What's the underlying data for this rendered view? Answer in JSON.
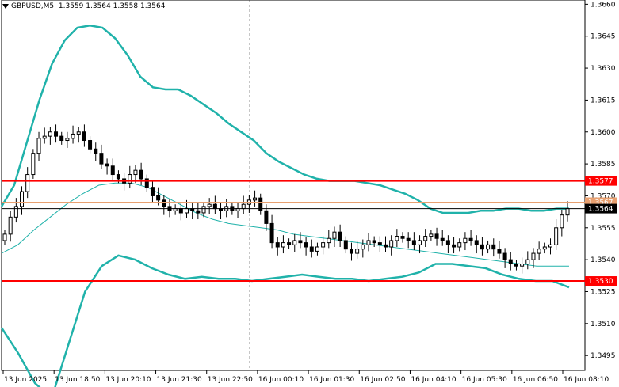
{
  "header": {
    "symbol": "GBPUSD,M5",
    "ohlc": "1.3559 1.3564 1.3558 1.3564"
  },
  "colors": {
    "band": "#20b2aa",
    "level": "#ff0000",
    "current": "#e8a070",
    "candle": "#000000",
    "axis": "#000000"
  },
  "chart_data": {
    "type": "candlestick",
    "ylim": [
      1.3488,
      1.3662
    ],
    "y_ticks": [
      "1.3660",
      "1.3645",
      "1.3630",
      "1.3615",
      "1.3600",
      "1.3585",
      "1.3570",
      "1.3555",
      "1.3540",
      "1.3525",
      "1.3510",
      "1.3495"
    ],
    "x_ticks": [
      "13 Jun 2025",
      "13 Jun 18:50",
      "13 Jun 20:10",
      "13 Jun 21:30",
      "13 Jun 22:50",
      "16 Jun 00:10",
      "16 Jun 01:30",
      "16 Jun 02:50",
      "16 Jun 04:10",
      "16 Jun 05:30",
      "16 Jun 06:50",
      "16 Jun 08:10"
    ],
    "horizontal_levels": [
      {
        "label": "1.3577",
        "value": 1.3577,
        "color": "#ff0000"
      },
      {
        "label": "1.3530",
        "value": 1.353,
        "color": "#ff0000"
      }
    ],
    "price_tags": [
      {
        "label": "1.3567",
        "value": 1.3567,
        "color": "#e8a070"
      },
      {
        "label": "1.3564",
        "value": 1.3564,
        "color": "#000000"
      }
    ],
    "closes": [
      1.3552,
      1.356,
      1.3565,
      1.3572,
      1.358,
      1.359,
      1.3597,
      1.3598,
      1.36,
      1.3598,
      1.3596,
      1.3597,
      1.3599,
      1.36,
      1.3596,
      1.3592,
      1.359,
      1.3585,
      1.3584,
      1.358,
      1.3578,
      1.3576,
      1.358,
      1.3582,
      1.3578,
      1.3574,
      1.357,
      1.3568,
      1.3565,
      1.3563,
      1.3564,
      1.3562,
      1.3564,
      1.3563,
      1.3562,
      1.3565,
      1.3566,
      1.3564,
      1.3563,
      1.3565,
      1.3563,
      1.3564,
      1.3566,
      1.3568,
      1.3569,
      1.3563,
      1.3557,
      1.3548,
      1.3546,
      1.3548,
      1.3547,
      1.3549,
      1.3548,
      1.3546,
      1.3544,
      1.3546,
      1.3548,
      1.355,
      1.3553,
      1.3549,
      1.3545,
      1.3543,
      1.3545,
      1.3547,
      1.3549,
      1.3548,
      1.3547,
      1.3546,
      1.3549,
      1.3551,
      1.355,
      1.3549,
      1.3547,
      1.3549,
      1.3551,
      1.3552,
      1.355,
      1.3549,
      1.3547,
      1.3546,
      1.3548,
      1.355,
      1.3549,
      1.3547,
      1.3545,
      1.3547,
      1.3545,
      1.3543,
      1.354,
      1.3538,
      1.3537,
      1.3538,
      1.354,
      1.3543,
      1.3545,
      1.3546,
      1.3547,
      1.3555,
      1.3561,
      1.3564
    ],
    "upper_band": [
      1.3565,
      1.3575,
      1.3595,
      1.3615,
      1.3632,
      1.3643,
      1.3649,
      1.365,
      1.3649,
      1.3644,
      1.3636,
      1.3626,
      1.3621,
      1.362,
      1.362,
      1.3617,
      1.3613,
      1.3609,
      1.3604,
      1.36,
      1.3596,
      1.359,
      1.3586,
      1.3583,
      1.358,
      1.3578,
      1.3577,
      1.3577,
      1.3577,
      1.3576,
      1.3575,
      1.3573,
      1.3571,
      1.3568,
      1.3564,
      1.3562,
      1.3562,
      1.3562,
      1.3563,
      1.3563,
      1.3564,
      1.3564,
      1.3563,
      1.3563,
      1.3564,
      1.3564
    ],
    "middle_band": [
      1.3543,
      1.3547,
      1.3554,
      1.356,
      1.3566,
      1.3571,
      1.3575,
      1.3576,
      1.3576,
      1.3574,
      1.357,
      1.3566,
      1.3562,
      1.3559,
      1.3557,
      1.3556,
      1.3555,
      1.3554,
      1.3552,
      1.3551,
      1.355,
      1.3549,
      1.3548,
      1.3547,
      1.3546,
      1.3545,
      1.3544,
      1.3543,
      1.3542,
      1.3541,
      1.354,
      1.3539,
      1.3538,
      1.3537,
      1.3537,
      1.3537
    ],
    "lower_band": [
      1.3508,
      1.3496,
      1.3482,
      1.3475,
      1.35,
      1.3525,
      1.3537,
      1.3542,
      1.354,
      1.3536,
      1.3533,
      1.3531,
      1.3532,
      1.3531,
      1.3531,
      1.353,
      1.3531,
      1.3532,
      1.3533,
      1.3532,
      1.3531,
      1.3531,
      1.353,
      1.3531,
      1.3532,
      1.3534,
      1.3538,
      1.3538,
      1.3537,
      1.3536,
      1.3533,
      1.3531,
      1.353,
      1.353,
      1.3527
    ]
  }
}
